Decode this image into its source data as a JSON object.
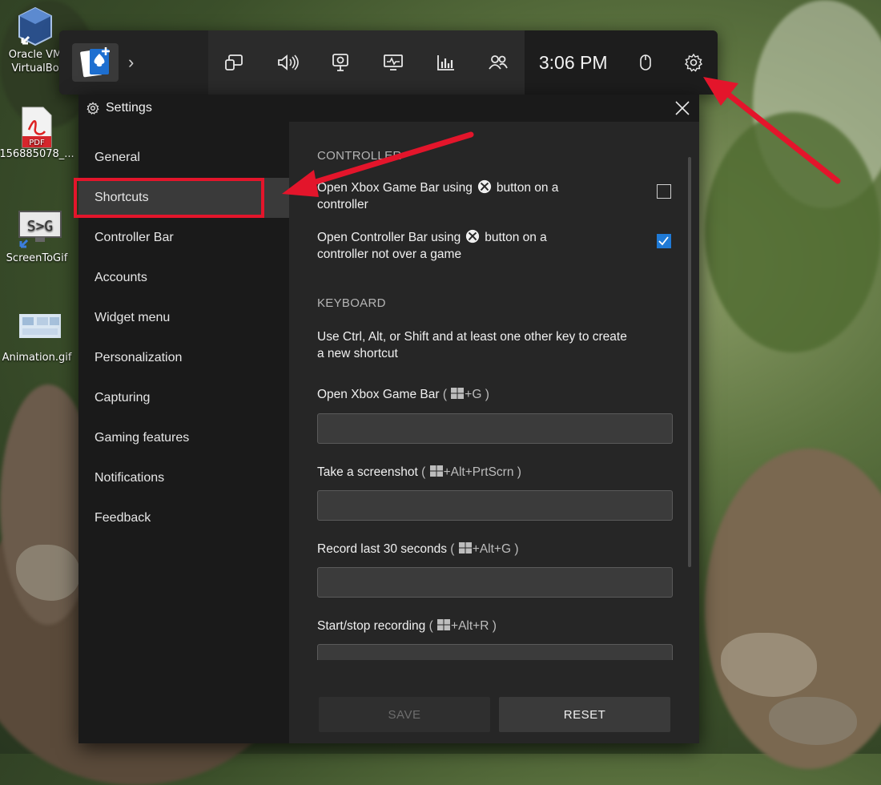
{
  "desktop": {
    "icons": [
      {
        "name": "virtualbox",
        "label_line1": "Oracle VM",
        "label_line2": "VirtualBo"
      },
      {
        "name": "pdf",
        "label": "156885078_..."
      },
      {
        "name": "screentogif",
        "label": "ScreenToGif"
      },
      {
        "name": "animation",
        "label": "Animation.gif"
      }
    ],
    "pdf_badge": "PDF",
    "s2g_badge": "S>G"
  },
  "gamebar": {
    "clock": "3:06 PM",
    "icons": [
      "widget-icon",
      "audio-icon",
      "capture-icon",
      "performance-icon",
      "resources-icon",
      "xbox-social-icon"
    ]
  },
  "settings": {
    "title": "Settings",
    "nav": [
      {
        "label": "General",
        "active": false
      },
      {
        "label": "Shortcuts",
        "active": true
      },
      {
        "label": "Controller Bar",
        "active": false
      },
      {
        "label": "Accounts",
        "active": false
      },
      {
        "label": "Widget menu",
        "active": false
      },
      {
        "label": "Personalization",
        "active": false
      },
      {
        "label": "Capturing",
        "active": false
      },
      {
        "label": "Gaming features",
        "active": false
      },
      {
        "label": "Notifications",
        "active": false
      },
      {
        "label": "Feedback",
        "active": false
      }
    ],
    "controller": {
      "heading": "CONTROLLER",
      "opt1_pre": "Open Xbox Game Bar using",
      "opt1_post": "button on a",
      "opt1_line2": "controller",
      "opt1_checked": false,
      "opt2_pre": "Open Controller Bar using",
      "opt2_post": "button on a",
      "opt2_line2": "controller not over a game",
      "opt2_checked": true
    },
    "keyboard": {
      "heading": "KEYBOARD",
      "desc_line1": "Use Ctrl, Alt, or Shift and at least one other key to create",
      "desc_line2": "a new shortcut",
      "shortcuts": [
        {
          "label": "Open Xbox Game Bar",
          "keys": "+G"
        },
        {
          "label": "Take a screenshot",
          "keys": "+Alt+PrtScrn"
        },
        {
          "label": "Record last 30 seconds",
          "keys": "+Alt+G"
        },
        {
          "label": "Start/stop recording",
          "keys": "+Alt+R"
        }
      ]
    },
    "save_label": "SAVE",
    "reset_label": "RESET"
  }
}
